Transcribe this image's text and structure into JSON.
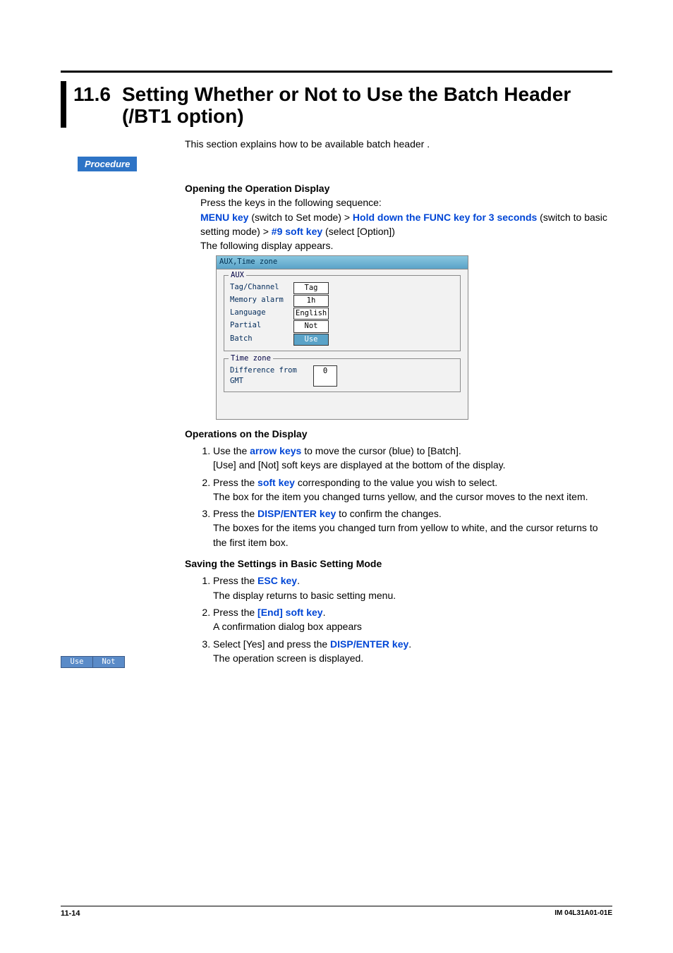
{
  "section": {
    "number": "11.6",
    "title": "Setting Whether or Not to Use the Batch Header  (/BT1 option)"
  },
  "intro": "This section explains how to be available batch header  .",
  "procedure_label": "Procedure",
  "opening": {
    "heading": "Opening the Operation Display",
    "line1": "Press the keys in the following sequence:",
    "menu_key": "MENU key",
    "seq1_plain1": " (switch to Set mode) > ",
    "func_key": "Hold down the FUNC key for 3 seconds",
    "seq1_plain2": " (switch to basic setting mode) > ",
    "soft_key9": "#9 soft key",
    "seq1_plain3": " (select [Option])",
    "line3": "The following display appears."
  },
  "device": {
    "titlebar": "AUX,Time zone",
    "group1": "AUX",
    "rows1": [
      {
        "label": "Tag/Channel",
        "value": "Tag",
        "sel": false
      },
      {
        "label": "Memory alarm",
        "value": "1h",
        "sel": false
      },
      {
        "label": "Language",
        "value": "English",
        "sel": false
      },
      {
        "label": "Partial",
        "value": "Not",
        "sel": false
      },
      {
        "label": "Batch",
        "value": "Use",
        "sel": true
      }
    ],
    "group2": "Time zone",
    "row2": {
      "label": "Difference from GMT",
      "value": "0"
    },
    "softkeys": [
      "Use",
      "Not"
    ]
  },
  "ops": {
    "heading": "Operations on the Display",
    "items": [
      {
        "pre": "Use the ",
        "key": "arrow keys",
        "post": " to move the cursor (blue) to [Batch].",
        "follow": "[Use] and [Not] soft keys are displayed at the bottom of the display."
      },
      {
        "pre": "Press the ",
        "key": "soft key",
        "post": " corresponding to the value you wish to select.",
        "follow": "The box for the item you changed turns yellow, and the cursor moves to the next item."
      },
      {
        "pre": "Press the ",
        "key": "DISP/ENTER key",
        "post": " to confirm the changes.",
        "follow": "The boxes for the items you changed turn from yellow to white, and the cursor returns to the first item box."
      }
    ]
  },
  "saving": {
    "heading": "Saving the Settings in Basic Setting Mode",
    "items": [
      {
        "pre": "Press the ",
        "key": "ESC key",
        "post": ".",
        "follow": "The display returns to basic setting menu."
      },
      {
        "pre": "Press the ",
        "key": "[End] soft key",
        "post": ".",
        "follow": "A confirmation dialog box appears"
      },
      {
        "pre": "Select [Yes] and press the ",
        "key": "DISP/ENTER key",
        "post": ".",
        "follow": "The operation screen is displayed."
      }
    ]
  },
  "footer": {
    "left": "11-14",
    "right": "IM 04L31A01-01E"
  }
}
